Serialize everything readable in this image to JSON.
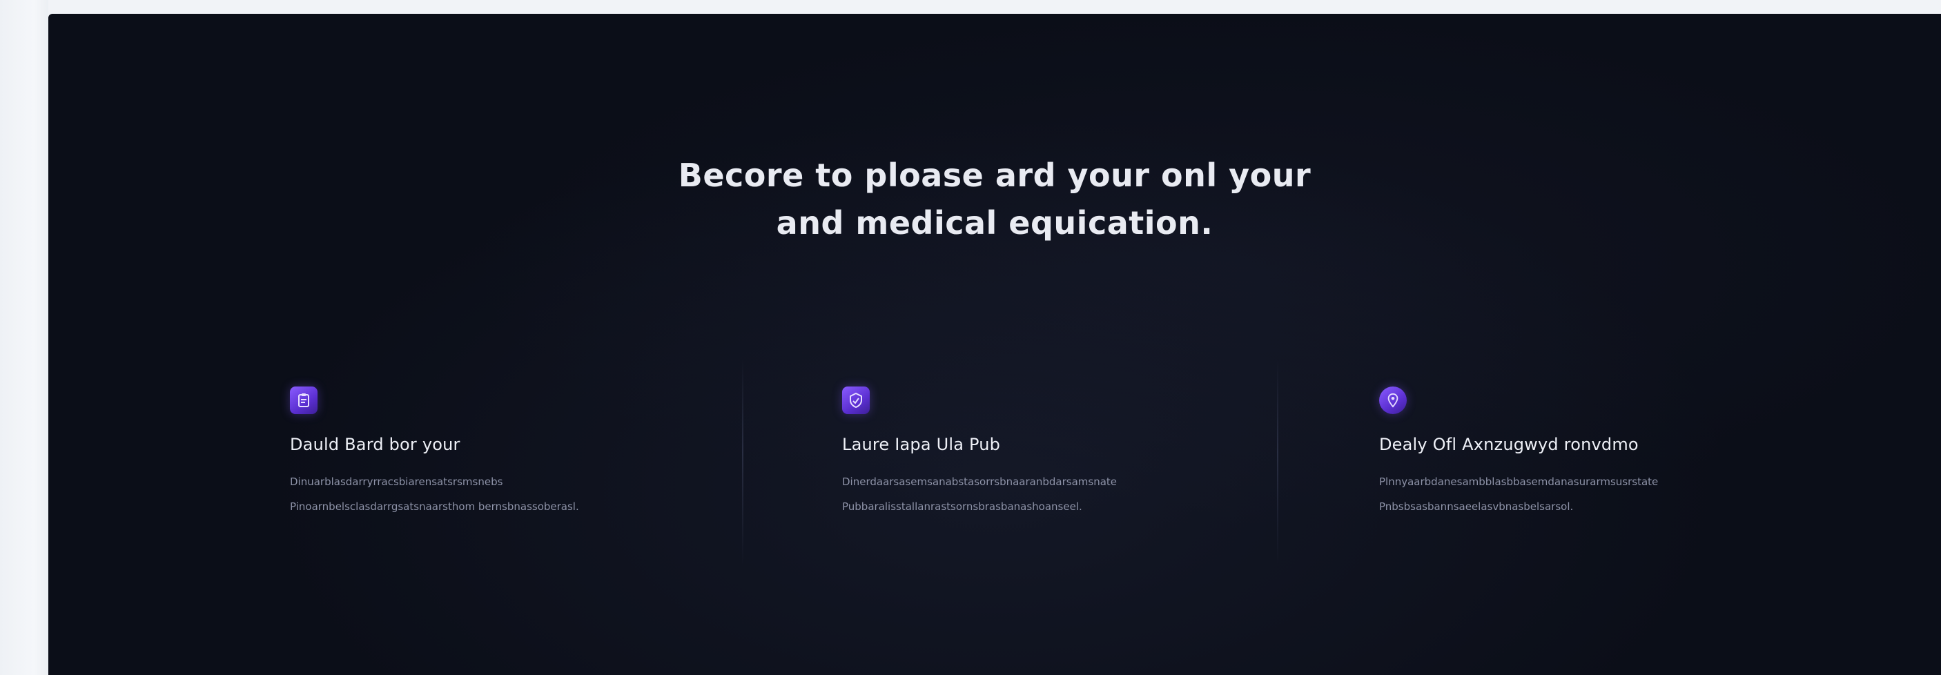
{
  "hero": {
    "line1": "Becore to ploase ard your onl your",
    "line2": "and medical equication."
  },
  "features": [
    {
      "icon": "clipboard-icon",
      "title": "Dauld Bard bor your",
      "description": "Dinuarblasdarryrracsbiarensatsrsmsnebs Pinoarnbelsclasdarrgsatsnaarsthom bernsbnassoberasl."
    },
    {
      "icon": "shield-icon",
      "title": "Laure Iapa Ula Pub",
      "description": "Dinerdaarsasemsanabstasorrsbnaaranbdarsamsnate Pubbaralisstallanrastsornsbrasbanashoanseel."
    },
    {
      "icon": "location-pin-icon",
      "title": "Dealy Ofl Axnzugwyd ronvdmo",
      "description": "Plnnyaarbdanesambblasbbasemdanasurarmsusrstate Pnbsbsasbannsaeelasvbnasbelsarsol."
    }
  ],
  "colors": {
    "panel_bg": "#0b0e18",
    "accent": "#7a4dff",
    "title_text": "#e9ebf2",
    "desc_text": "#8e93a8"
  }
}
